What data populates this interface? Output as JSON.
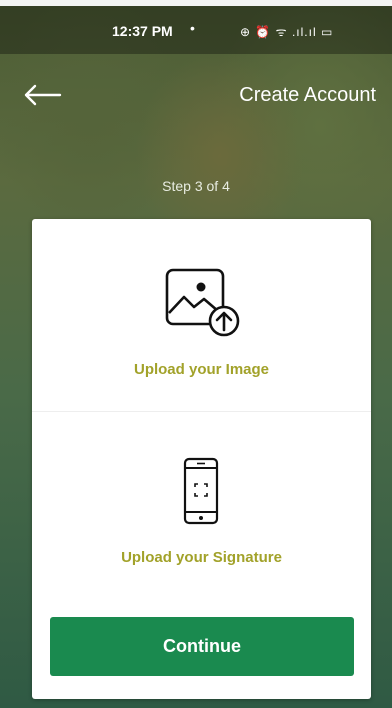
{
  "status_bar": {
    "time": "12:37 PM",
    "separator": "•",
    "icons_text": "⊕ ⏰ ᯤ .ıl.ıl ▭",
    "icon_names": [
      "location-icon",
      "alarm-icon",
      "wifi-icon",
      "signal-icon",
      "battery-icon"
    ]
  },
  "header": {
    "back_icon": "back-arrow-icon",
    "title": "Create Account"
  },
  "step": {
    "label": "Step 3 of 4"
  },
  "card": {
    "upload_image": {
      "icon": "image-upload-icon",
      "label": "Upload your Image"
    },
    "upload_signature": {
      "icon": "phone-scan-icon",
      "label": "Upload your Signature"
    },
    "continue_label": "Continue"
  },
  "colors": {
    "accent_text": "#a2a22a",
    "button": "#1a8a4f",
    "card": "#ffffff"
  }
}
